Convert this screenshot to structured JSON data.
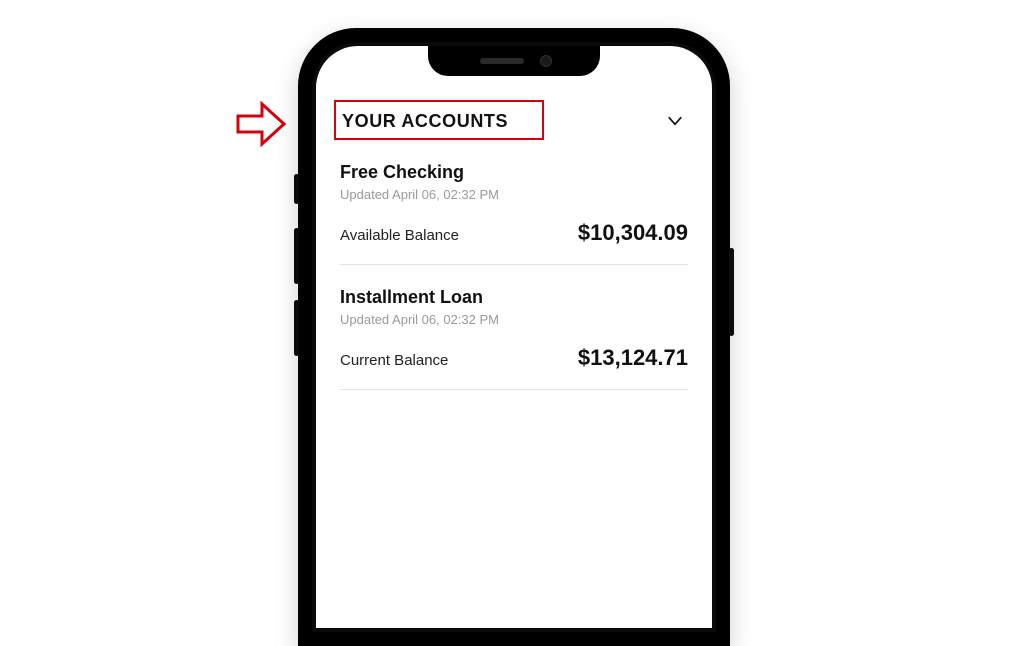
{
  "annotation": {
    "arrow_color": "#d8000c",
    "highlight_color": "#d8000c"
  },
  "section": {
    "title": "YOUR ACCOUNTS"
  },
  "accounts": [
    {
      "name": "Free Checking",
      "updated": "Updated April 06, 02:32 PM",
      "balance_label": "Available Balance",
      "balance_value": "$10,304.09"
    },
    {
      "name": "Installment Loan",
      "updated": "Updated April 06, 02:32 PM",
      "balance_label": "Current Balance",
      "balance_value": "$13,124.71"
    }
  ]
}
